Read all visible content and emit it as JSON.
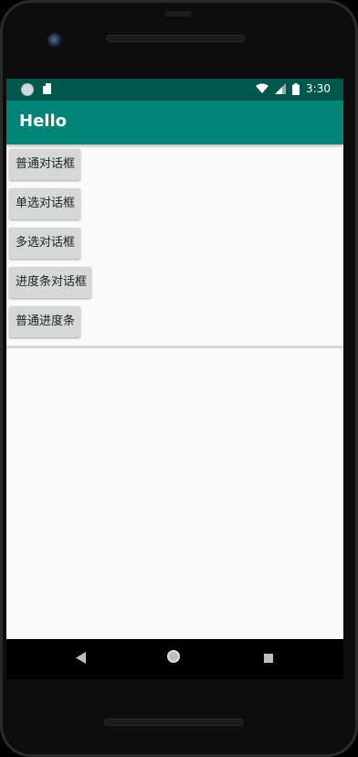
{
  "status_bar": {
    "time": "3:30",
    "icons": [
      "circle-notification-icon",
      "sd-card-icon",
      "wifi-icon",
      "signal-icon",
      "battery-icon"
    ]
  },
  "app_bar": {
    "title": "Hello"
  },
  "buttons": [
    {
      "label": "普通对话框"
    },
    {
      "label": "单选对话框"
    },
    {
      "label": "多选对话框"
    },
    {
      "label": "进度条对话框"
    },
    {
      "label": "普通进度条"
    }
  ],
  "nav_bar": {
    "icons": [
      "back-icon",
      "home-icon",
      "recents-icon"
    ]
  },
  "colors": {
    "status_bar": "#00574b",
    "app_bar": "#008577",
    "button_bg": "#d6d7d7",
    "screen_bg": "#fafafa"
  }
}
